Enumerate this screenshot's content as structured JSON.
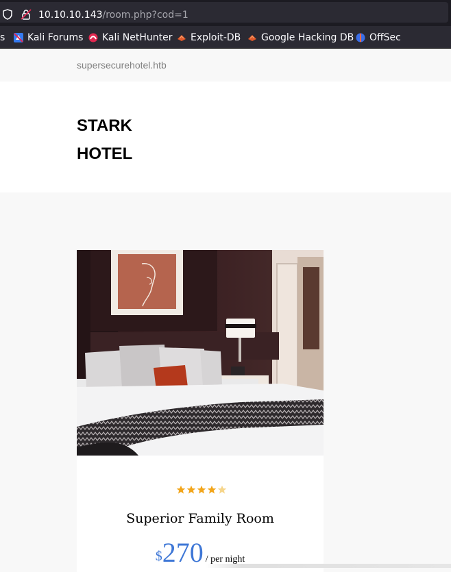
{
  "browser": {
    "url_host": "10.10.10.143",
    "url_path": "/room.php?cod=1",
    "bookmarks": [
      {
        "label": "s",
        "icon": "none"
      },
      {
        "label": "Kali Forums",
        "icon": "kali-forums-icon"
      },
      {
        "label": "Kali NetHunter",
        "icon": "nethunter-icon"
      },
      {
        "label": "Exploit-DB",
        "icon": "exploit-db-icon"
      },
      {
        "label": "Google Hacking DB",
        "icon": "ghdb-icon"
      },
      {
        "label": "OffSec",
        "icon": "offsec-icon"
      }
    ]
  },
  "site": {
    "domain": "supersecurehotel.htb",
    "brand_line1": "STARK",
    "brand_line2": "HOTEL"
  },
  "room": {
    "rating": 4,
    "rating_max": 5,
    "name": "Superior Family Room",
    "currency": "$",
    "price": "270",
    "per_night": "/ per night"
  },
  "colors": {
    "accent": "#3e77d6",
    "star": "#f2a51a",
    "star_empty": "#f6d58a"
  }
}
